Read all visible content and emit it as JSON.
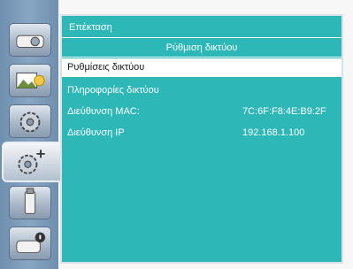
{
  "sidebar": {
    "tabs": [
      {
        "icon": "projector-icon"
      },
      {
        "icon": "image-adjust-icon"
      },
      {
        "icon": "gear-icon"
      },
      {
        "icon": "extended-settings-icon",
        "active": true
      },
      {
        "icon": "usb-icon"
      },
      {
        "icon": "projector-info-icon"
      }
    ]
  },
  "panel": {
    "title": "Επέκταση",
    "subtitle": "Ρύθμιση δικτύου",
    "items": [
      {
        "label": "Ρυθμίσεις δικτύου",
        "value": "",
        "selected": true
      },
      {
        "label": "Πληροφορίες δικτύου",
        "value": ""
      },
      {
        "label": "Διεύθυνση MAC:",
        "value": "7C:6F:F8:4E:B9:2F"
      },
      {
        "label": "Διεύθυνση IP",
        "value": "192.168.1.100"
      }
    ]
  },
  "colors": {
    "panel_bg": "#2db7b7",
    "selected_bg": "#ffffff",
    "sidebar": "#7b98b8"
  }
}
